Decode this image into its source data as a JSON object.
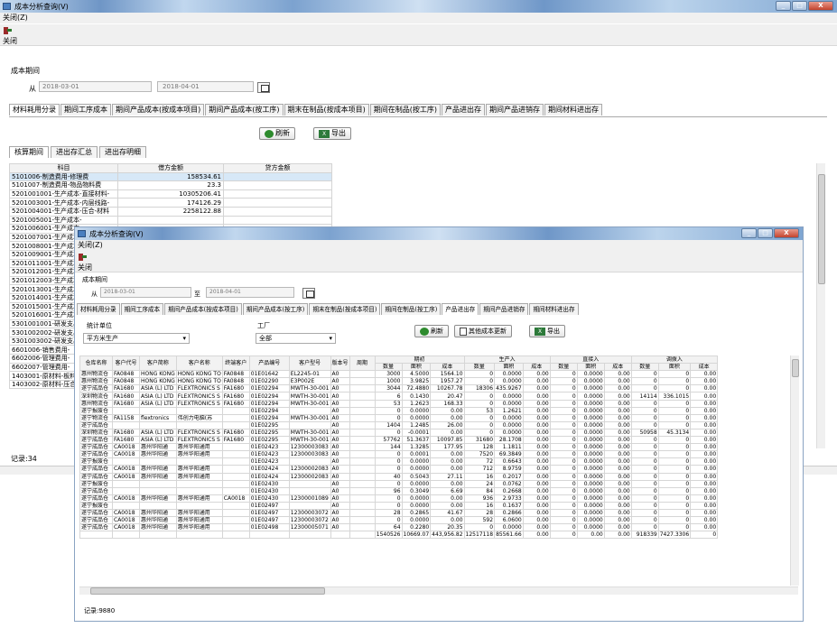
{
  "window": {
    "title": "成本分析查询(V)",
    "menu": "关闭(Z)",
    "close_label": "关闭"
  },
  "period": {
    "group_label": "成本期间",
    "from_label": "从",
    "to_label": "至",
    "from_value": "2018-03-01",
    "to_value": "2018-04-01"
  },
  "tabs": [
    "材料耗用分录",
    "期间工序成本",
    "期间产品成本(按成本项目)",
    "期间产品成本(按工序)",
    "期末在制品(按成本项目)",
    "期间在制品(按工序)",
    "产品进出存",
    "期间产品进销存",
    "期间材料进出存"
  ],
  "buttons": {
    "refresh": "刷新",
    "export": "导出",
    "other_cost_update": "其他成本更新"
  },
  "subtabs": [
    "核算期间",
    "进出存汇总",
    "进出存明细"
  ],
  "bg_table": {
    "headers": [
      "科目",
      "借方金额",
      "贷方金额"
    ],
    "rows": [
      [
        "5101006-制造费用-修理费",
        "158534.61",
        ""
      ],
      [
        "5101007-制造费用-物品物料费",
        "23.3",
        ""
      ],
      [
        "5201001001-生产成本-直接材料-",
        "10305206.41",
        ""
      ],
      [
        "5201003001-生产成本-内层线路-",
        "174126.29",
        ""
      ],
      [
        "5201004001-生产成本-压合-材料",
        "2258122.88",
        ""
      ],
      [
        "5201005001-生产成本-",
        "",
        ""
      ],
      [
        "5201006001-生产成本-",
        "",
        ""
      ],
      [
        "5201007001-生产成本-",
        "",
        ""
      ],
      [
        "5201008001-生产成本-",
        "",
        ""
      ],
      [
        "5201009001-生产成本-",
        "",
        ""
      ],
      [
        "5201011001-生产成本-",
        "",
        ""
      ],
      [
        "5201012001-生产成本-",
        "",
        ""
      ],
      [
        "5201012003-生产成本-",
        "",
        ""
      ],
      [
        "5201013001-生产成本-",
        "",
        ""
      ],
      [
        "5201014001-生产成本-",
        "",
        ""
      ],
      [
        "5201015001-生产成本-",
        "",
        ""
      ],
      [
        "5201016001-生产成本-",
        "",
        ""
      ],
      [
        "5301001001-研发支出-",
        "",
        ""
      ],
      [
        "5301002002-研发支出-",
        "",
        ""
      ],
      [
        "5301003002-研发支出-",
        "",
        ""
      ],
      [
        "6601006-销售费用-",
        "",
        ""
      ],
      [
        "6602006-管理费用-",
        "",
        ""
      ],
      [
        "6602007-管理费用-",
        "",
        ""
      ],
      [
        "1403001-原材料-板料",
        "",
        ""
      ],
      [
        "1403002-原材料-压合",
        "",
        ""
      ]
    ],
    "record_label": "记录:34"
  },
  "win2": {
    "title": "成本分析查询(V)",
    "menu": "关闭(Z)",
    "close_label": "关闭",
    "unit_label": "统计单位",
    "unit_value": "平方米生产",
    "factory_label": "工厂",
    "factory_value": "全部",
    "headers_top": [
      "仓库名称",
      "客户代号",
      "客户简称",
      "客户名称",
      "终端客户",
      "产品编号",
      "客户型号",
      "版本号",
      "周期",
      "期初",
      "生产入",
      "直接入",
      "调拨入"
    ],
    "headers_sub": [
      "数量",
      "面积",
      "成本"
    ],
    "rows": [
      [
        "惠州物流仓",
        "FA0848",
        "HONG KONG",
        "HONG KONG TO",
        "FA0848",
        "01E01642",
        "EL2245-01",
        "A0",
        "",
        "3000",
        "4.5000",
        "1564.10",
        "0",
        "0.0000",
        "0.00",
        "0",
        "0.0000",
        "0.00",
        "0",
        "0",
        "0.00"
      ],
      [
        "惠州物流仓",
        "FA0848",
        "HONG KONG",
        "HONG KONG TO",
        "FA0848",
        "01E02290",
        "E3P002E",
        "A0",
        "",
        "1000",
        "3.9825",
        "1957.27",
        "0",
        "0.0000",
        "0.00",
        "0",
        "0.0000",
        "0.00",
        "0",
        "0",
        "0.00"
      ],
      [
        "遂宁成品仓",
        "FA1680",
        "ASIA (L) LTD",
        "FLEXTRONICS S",
        "FA1680",
        "01E02294",
        "MWTH-30-001",
        "A0",
        "",
        "3044",
        "72.4880",
        "10267.78",
        "18306",
        "435.9267",
        "0.00",
        "0",
        "0.0000",
        "0.00",
        "0",
        "0",
        "0.00"
      ],
      [
        "深圳物流仓",
        "FA1680",
        "ASIA (L) LTD",
        "FLEXTRONICS S",
        "FA1680",
        "01E02294",
        "MWTH-30-001",
        "A0",
        "",
        "6",
        "0.1430",
        "20.47",
        "0",
        "0.0000",
        "0.00",
        "0",
        "0.0000",
        "0.00",
        "14114",
        "336.1015",
        "0.00"
      ],
      [
        "惠州物流仓",
        "FA1680",
        "ASIA (L) LTD",
        "FLEXTRONICS S",
        "FA1680",
        "01E02294",
        "MWTH-30-001",
        "A0",
        "",
        "53",
        "1.2623",
        "168.33",
        "0",
        "0.0000",
        "0.00",
        "0",
        "0.0000",
        "0.00",
        "0",
        "0",
        "0.00"
      ],
      [
        "遂宁报废仓",
        "",
        "",
        "",
        "",
        "01E02294",
        "",
        "A0",
        "",
        "0",
        "0.0000",
        "0.00",
        "53",
        "1.2621",
        "0.00",
        "0",
        "0.0000",
        "0.00",
        "0",
        "0",
        "0.00"
      ],
      [
        "遂宁物流仓",
        "FA1158",
        "flextronics",
        "伟创力电脑(苏",
        "",
        "01E02294",
        "MWTH-30-001",
        "A0",
        "",
        "0",
        "0.0000",
        "0.00",
        "0",
        "0.0000",
        "0.00",
        "0",
        "0.0000",
        "0.00",
        "0",
        "0",
        "0.00"
      ],
      [
        "遂宁成品仓",
        "",
        "",
        "",
        "",
        "01E02295",
        "",
        "A0",
        "",
        "1404",
        "1.2485",
        "26.00",
        "0",
        "0.0000",
        "0.00",
        "0",
        "0.0000",
        "0.00",
        "0",
        "0",
        "0.00"
      ],
      [
        "深圳物流仓",
        "FA1680",
        "ASIA (L) LTD",
        "FLEXTRONICS S",
        "FA1680",
        "01E02295",
        "MWTH-30-001",
        "A0",
        "",
        "0",
        "-0.0001",
        "0.00",
        "0",
        "0.0000",
        "0.00",
        "0",
        "0.0000",
        "0.00",
        "50958",
        "45.3134",
        "0.00"
      ],
      [
        "遂宁成品仓",
        "FA1680",
        "ASIA (L) LTD",
        "FLEXTRONICS S",
        "FA1680",
        "01E02295",
        "MWTH-30-001",
        "A0",
        "",
        "57762",
        "51.3637",
        "10097.85",
        "31680",
        "28.1708",
        "0.00",
        "0",
        "0.0000",
        "0.00",
        "0",
        "0",
        "0.00"
      ],
      [
        "遂宁成品仓",
        "CA0018",
        "惠州华阳通",
        "惠州华阳通用",
        "",
        "01E02423",
        "12300003083",
        "A0",
        "",
        "144",
        "1.3285",
        "177.95",
        "128",
        "1.1811",
        "0.00",
        "0",
        "0.0000",
        "0.00",
        "0",
        "0",
        "0.00"
      ],
      [
        "遂宁成品仓",
        "CA0018",
        "惠州华阳通",
        "惠州华阳通用",
        "",
        "01E02423",
        "12300003083",
        "A0",
        "",
        "0",
        "0.0001",
        "0.00",
        "7520",
        "69.3849",
        "0.00",
        "0",
        "0.0000",
        "0.00",
        "0",
        "0",
        "0.00"
      ],
      [
        "遂宁报废仓",
        "",
        "",
        "",
        "",
        "01E02423",
        "",
        "A0",
        "",
        "0",
        "0.0000",
        "0.00",
        "72",
        "0.6643",
        "0.00",
        "0",
        "0.0000",
        "0.00",
        "0",
        "0",
        "0.00"
      ],
      [
        "遂宁成品仓",
        "CA0018",
        "惠州华阳通",
        "惠州华阳通用",
        "",
        "01E02424",
        "12300002083",
        "A0",
        "",
        "0",
        "0.0000",
        "0.00",
        "712",
        "8.9759",
        "0.00",
        "0",
        "0.0000",
        "0.00",
        "0",
        "0",
        "0.00"
      ],
      [
        "遂宁成品仓",
        "CA0018",
        "惠州华阳通",
        "惠州华阳通用",
        "",
        "01E02424",
        "12300002083",
        "A0",
        "",
        "40",
        "0.5043",
        "27.11",
        "16",
        "0.2017",
        "0.00",
        "0",
        "0.0000",
        "0.00",
        "0",
        "0",
        "0.00"
      ],
      [
        "遂宁报废仓",
        "",
        "",
        "",
        "",
        "01E02430",
        "",
        "A0",
        "",
        "0",
        "0.0000",
        "0.00",
        "24",
        "0.0762",
        "0.00",
        "0",
        "0.0000",
        "0.00",
        "0",
        "0",
        "0.00"
      ],
      [
        "遂宁成品仓",
        "",
        "",
        "",
        "",
        "01E02430",
        "",
        "A0",
        "",
        "96",
        "0.3049",
        "6.69",
        "84",
        "0.2668",
        "0.00",
        "0",
        "0.0000",
        "0.00",
        "0",
        "0",
        "0.00"
      ],
      [
        "遂宁成品仓",
        "CA0018",
        "惠州华阳通",
        "惠州华阳通用",
        "CA0018",
        "01E02430",
        "12300001089",
        "A0",
        "",
        "0",
        "0.0000",
        "0.00",
        "936",
        "2.9733",
        "0.00",
        "0",
        "0.0000",
        "0.00",
        "0",
        "0",
        "0.00"
      ],
      [
        "遂宁报废仓",
        "",
        "",
        "",
        "",
        "01E02497",
        "",
        "A0",
        "",
        "0",
        "0.0000",
        "0.00",
        "16",
        "0.1637",
        "0.00",
        "0",
        "0.0000",
        "0.00",
        "0",
        "0",
        "0.00"
      ],
      [
        "遂宁成品仓",
        "CA0018",
        "惠州华阳通",
        "惠州华阳通用",
        "",
        "01E02497",
        "12300003072",
        "A0",
        "",
        "28",
        "0.2865",
        "41.67",
        "28",
        "0.2866",
        "0.00",
        "0",
        "0.0000",
        "0.00",
        "0",
        "0",
        "0.00"
      ],
      [
        "遂宁成品仓",
        "CA0018",
        "惠州华阳通",
        "惠州华阳通用",
        "",
        "01E02497",
        "12300003072",
        "A0",
        "",
        "0",
        "0.0000",
        "0.00",
        "592",
        "6.0600",
        "0.00",
        "0",
        "0.0000",
        "0.00",
        "0",
        "0",
        "0.00"
      ],
      [
        "遂宁成品仓",
        "CA0018",
        "惠州华阳通",
        "惠州华阳通用",
        "",
        "01E02498",
        "12300005071",
        "A0",
        "",
        "64",
        "0.2280",
        "20.35",
        "0",
        "0.0000",
        "0.00",
        "0",
        "0.0000",
        "0.00",
        "0",
        "0",
        "0.00"
      ]
    ],
    "totals": [
      "1540526",
      "10669.07",
      "443,956.82",
      "12517118",
      "85561.66",
      "0.00",
      "0",
      "0.00",
      "0.00",
      "918339",
      "7427.3306",
      "0"
    ],
    "record_label": "记录:9880"
  }
}
